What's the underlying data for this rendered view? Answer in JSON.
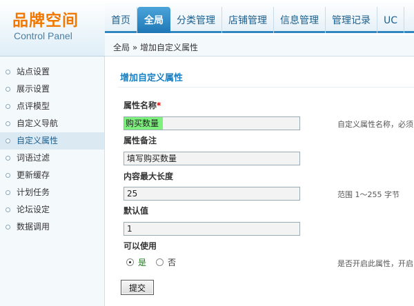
{
  "logo": {
    "cn": "品牌空间",
    "en": "Control Panel"
  },
  "nav": {
    "items": [
      {
        "label": "首页",
        "name": "nav-home"
      },
      {
        "label": "全局",
        "name": "nav-global",
        "active": true
      },
      {
        "label": "分类管理",
        "name": "nav-category"
      },
      {
        "label": "店铺管理",
        "name": "nav-shop"
      },
      {
        "label": "信息管理",
        "name": "nav-info"
      },
      {
        "label": "管理记录",
        "name": "nav-log"
      },
      {
        "label": "UC",
        "name": "nav-uc"
      }
    ]
  },
  "breadcrumb": "全局 » 增加自定义属性",
  "sidebar": {
    "items": [
      {
        "label": "站点设置"
      },
      {
        "label": "展示设置"
      },
      {
        "label": "点评模型"
      },
      {
        "label": "自定义导航"
      },
      {
        "label": "自定义属性",
        "active": true
      },
      {
        "label": "词语过滤"
      },
      {
        "label": "更新缓存"
      },
      {
        "label": "计划任务"
      },
      {
        "label": "论坛设定"
      },
      {
        "label": "数据调用"
      }
    ]
  },
  "form": {
    "title": "增加自定义属性",
    "name_label": "属性名称",
    "required_mark": "*",
    "name_value": "购买数量",
    "name_hint": "自定义属性名称，必须",
    "note_label": "属性备注",
    "note_value": "填写购买数量",
    "maxlen_label": "内容最大长度",
    "maxlen_value": "25",
    "maxlen_hint": "范围 1～255 字节",
    "default_label": "默认值",
    "default_value": "1",
    "enable_label": "可以使用",
    "enable_yes": "是",
    "enable_no": "否",
    "enable_hint": "是否开启此属性，开启",
    "submit_label": "提交"
  }
}
